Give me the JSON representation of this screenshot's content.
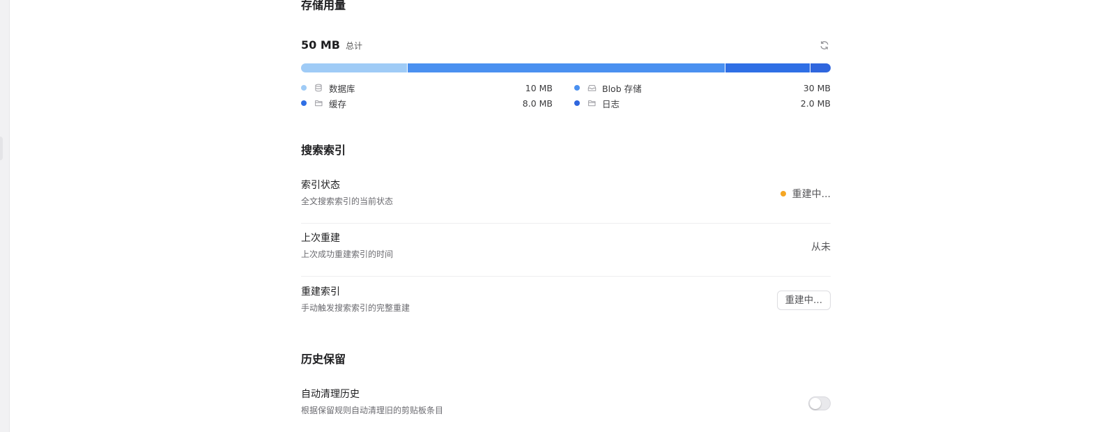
{
  "colors": {
    "database": "#9fcbf6",
    "blob": "#4a90f0",
    "cache": "#2f6fe5",
    "logs": "#2f66de",
    "status_rebuilding": "#f5a623"
  },
  "storage": {
    "title": "存储用量",
    "total_value": "50 MB",
    "total_label": "总计",
    "refresh_icon": "refresh-icon",
    "segments": [
      {
        "key": "database",
        "value_mb": 10
      },
      {
        "key": "blob",
        "value_mb": 30
      },
      {
        "key": "cache",
        "value_mb": 8
      },
      {
        "key": "logs",
        "value_mb": 2
      }
    ],
    "legend": {
      "database": {
        "label": "数据库",
        "value": "10 MB",
        "icon": "database-icon"
      },
      "blob": {
        "label": "Blob 存储",
        "value": "30 MB",
        "icon": "archive-box-icon"
      },
      "cache": {
        "label": "缓存",
        "value": "8.0 MB",
        "icon": "folder-icon"
      },
      "logs": {
        "label": "日志",
        "value": "2.0 MB",
        "icon": "folder-icon"
      }
    }
  },
  "search_index": {
    "title": "搜索索引",
    "status": {
      "title": "索引状态",
      "description": "全文搜索索引的当前状态",
      "value": "重建中..."
    },
    "last_rebuild": {
      "title": "上次重建",
      "description": "上次成功重建索引的时间",
      "value": "从未"
    },
    "rebuild": {
      "title": "重建索引",
      "description": "手动触发搜索索引的完整重建",
      "button_label": "重建中..."
    }
  },
  "history": {
    "title": "历史保留",
    "auto_clean": {
      "title": "自动清理历史",
      "description": "根据保留规则自动清理旧的剪贴板条目",
      "enabled": false
    }
  }
}
